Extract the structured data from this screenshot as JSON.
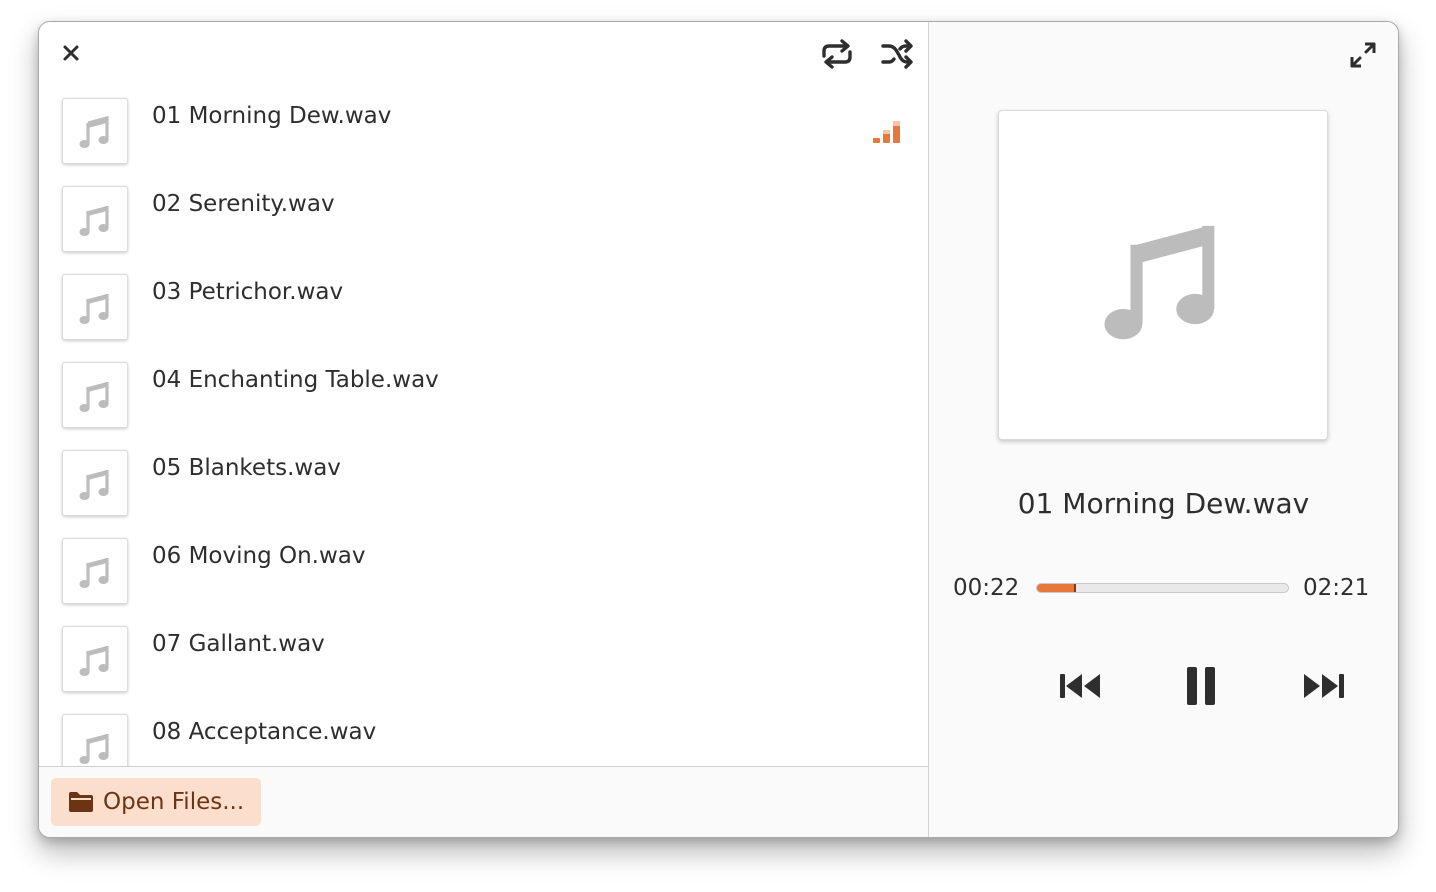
{
  "window": {
    "close_icon": "close-icon",
    "repeat_icon": "repeat-icon",
    "shuffle_icon": "shuffle-icon",
    "fullscreen_icon": "fullscreen-icon"
  },
  "playlist": {
    "tracks": [
      {
        "title": "01 Morning Dew.wav",
        "playing": true
      },
      {
        "title": "02 Serenity.wav",
        "playing": false
      },
      {
        "title": "03 Petrichor.wav",
        "playing": false
      },
      {
        "title": "04 Enchanting Table.wav",
        "playing": false
      },
      {
        "title": "05 Blankets.wav",
        "playing": false
      },
      {
        "title": "06 Moving On.wav",
        "playing": false
      },
      {
        "title": "07 Gallant.wav",
        "playing": false
      },
      {
        "title": "08 Acceptance.wav",
        "playing": false
      }
    ],
    "thumbnail_icon": "music-note-icon",
    "playing_icon": "signal-bars-icon"
  },
  "footer": {
    "open_files_label": "Open Files...",
    "open_files_icon": "folder-icon"
  },
  "now_playing": {
    "title": "01 Morning Dew.wav",
    "current_time": "00:22",
    "total_time": "02:21",
    "progress": 0.156,
    "cover_icon": "music-note-icon",
    "previous_icon": "skip-previous-icon",
    "pause_icon": "pause-icon",
    "next_icon": "skip-next-icon"
  },
  "colors": {
    "accent": "#e8783a",
    "button_bg": "#fbdfcc",
    "button_text": "#6b3515",
    "icon_gray": "#bcbcbc",
    "icon_dark": "#2e2e2e"
  }
}
